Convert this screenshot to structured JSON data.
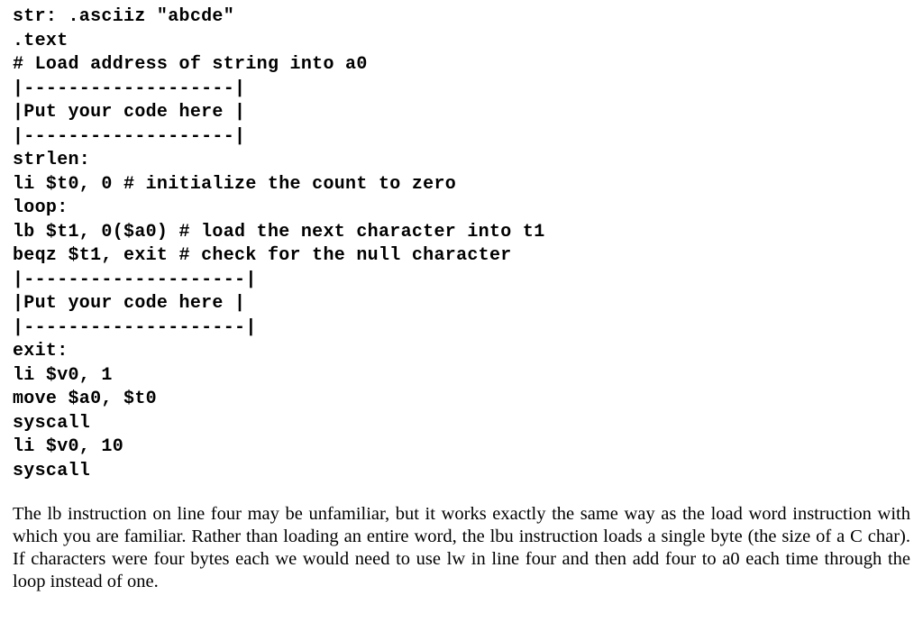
{
  "code": {
    "l01": "str: .asciiz \"abcde\"",
    "l02": ".text",
    "l03": "# Load address of string into a0",
    "l04": "|-------------------|",
    "l05": "|Put your code here |",
    "l06": "|-------------------|",
    "l07": "strlen:",
    "l08": "li $t0, 0 # initialize the count to zero",
    "l09": "loop:",
    "l10": "lb $t1, 0($a0) # load the next character into t1",
    "l11": "beqz $t1, exit # check for the null character",
    "l12": "|--------------------|",
    "l13": "|Put your code here |",
    "l14": "|--------------------|",
    "l15": "exit:",
    "l16": "li $v0, 1",
    "l17": "move $a0, $t0",
    "l18": "syscall",
    "l19": "li $v0, 10",
    "l20": "syscall"
  },
  "prose": {
    "p1": "The lb instruction on line four may be unfamiliar, but it works exactly the same way as the load word instruction with which you are familiar. Rather than loading an entire word, the lbu instruction loads a single byte (the size of a C char). If characters were four bytes each we would need to use lw in line four and then add four to a0 each time through the loop instead of one."
  }
}
